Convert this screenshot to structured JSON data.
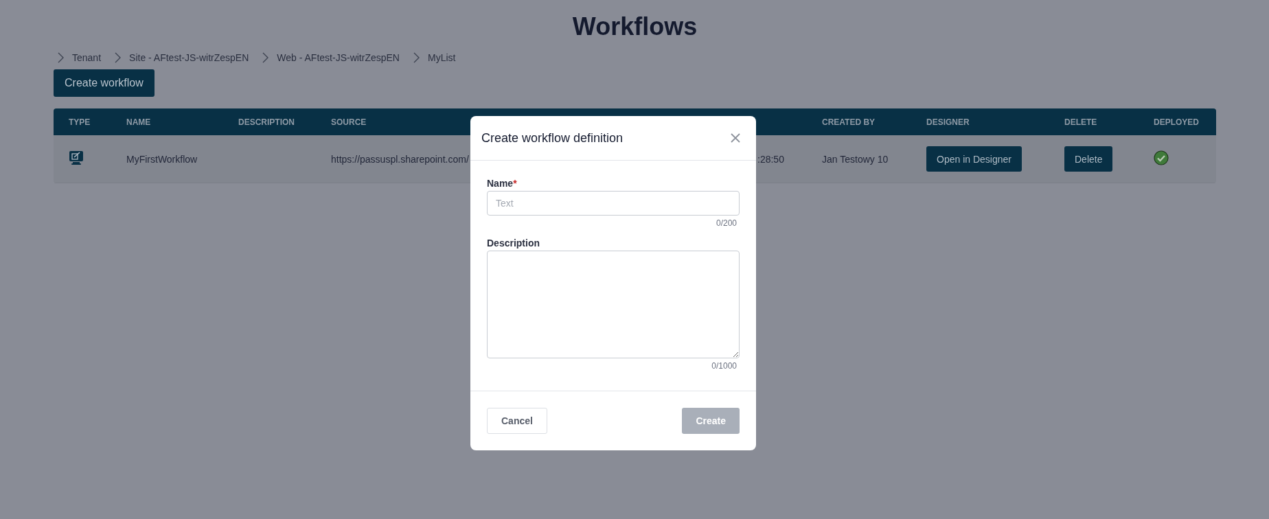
{
  "page_title": "Workflows",
  "breadcrumbs": [
    "Tenant",
    "Site - AFtest-JS-witrZespEN",
    "Web - AFtest-JS-witrZespEN",
    "MyList"
  ],
  "create_button": "Create workflow",
  "table": {
    "columns": [
      "TYPE",
      "NAME",
      "DESCRIPTION",
      "SOURCE",
      "CREATED BY",
      "DESIGNER",
      "DELETE",
      "DEPLOYED"
    ],
    "rows": [
      {
        "name": "MyFirstWorkflow",
        "source": "https://passuspl.sharepoint.com/",
        "column_5": ":28:50",
        "created_by": "Jan Testowy 10",
        "designer_button": "Open in Designer",
        "delete_button": "Delete",
        "deployed": true
      }
    ]
  },
  "dialog": {
    "title": "Create workflow definition",
    "fields": [
      {
        "kind": "input",
        "label": "Name",
        "required_mark": "*",
        "placeholder": "Text",
        "counter": "0/200"
      },
      {
        "kind": "textarea",
        "label": "Description",
        "counter": "0/1000"
      }
    ],
    "cancel_button": "Cancel",
    "create_button": {
      "label": "Create",
      "disabled": true
    }
  }
}
